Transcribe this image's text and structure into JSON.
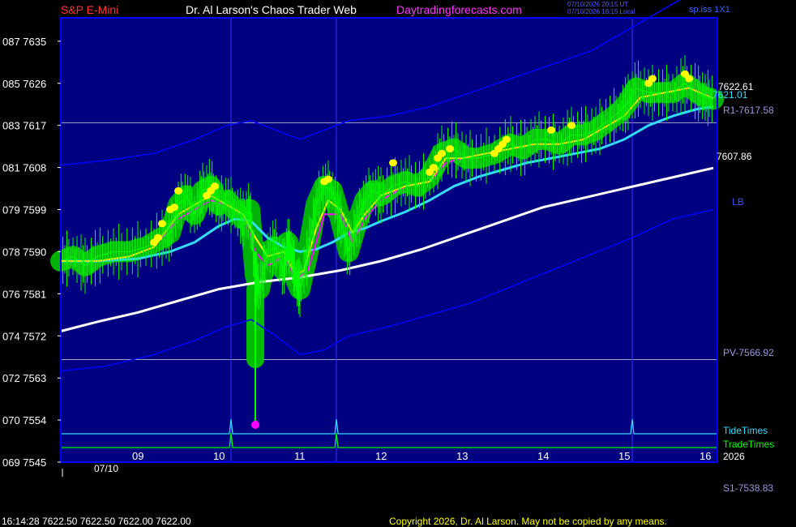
{
  "header": {
    "symbol": "S&P E-Mini",
    "author": "Dr. Al Larson's Chaos Trader Web",
    "site": "Daytradingforecasts.com",
    "stamp_utc": "07/10/2026 20:15 UT",
    "stamp_local": "07/10/2026 16:15 Local",
    "interval": "sp.iss 1X1"
  },
  "footer": {
    "quote": "16:14:28  7622.50 7622.50 7622.00 7622.00",
    "copyright": "Copyright 2026, Dr. Al Larson. May not be copied by any means."
  },
  "colors": {
    "background": "#000080",
    "frame": "#0000ff",
    "price": "#00ff00",
    "halo": "#00bb00",
    "fast_ma": "#ffff00",
    "mid_ma": "#ff00ff",
    "slow_ma": "#33ddff",
    "long_ma": "#ffffff",
    "band": "#0000ff",
    "tide": "#33ddff",
    "trade": "#00ff00",
    "marker": "#ff00ff",
    "dot": "#ffff00"
  },
  "chart_data": {
    "type": "line",
    "x_unit": "hour",
    "xlim": [
      8.05,
      16.15
    ],
    "ylim": [
      7545,
      7640
    ],
    "x_ticks": [
      9,
      10,
      11,
      12,
      13,
      14,
      15,
      16
    ],
    "x_tick_labels": [
      "09",
      "10",
      "11",
      "12",
      "13",
      "14",
      "15",
      "16"
    ],
    "date_label": "07/10",
    "year_label": "2026",
    "y_ticks": [
      {
        "price": 7635,
        "label": "087 7635"
      },
      {
        "price": 7626,
        "label": "085 7626"
      },
      {
        "price": 7617,
        "label": "083 7617"
      },
      {
        "price": 7608,
        "label": "081 7608"
      },
      {
        "price": 7599,
        "label": "079 7599"
      },
      {
        "price": 7590,
        "label": "078 7590"
      },
      {
        "price": 7581,
        "label": "076 7581"
      },
      {
        "price": 7572,
        "label": "074 7572"
      },
      {
        "price": 7563,
        "label": "072 7563"
      },
      {
        "price": 7554,
        "label": "070 7554"
      },
      {
        "price": 7545,
        "label": "069 7545"
      }
    ],
    "levels": [
      {
        "name": "R1",
        "value": 7617.58,
        "label": "R1-7617.58"
      },
      {
        "name": "PV",
        "value": 7566.92,
        "label": "PV-7566.92"
      },
      {
        "name": "S1",
        "value": 7538.83,
        "label": "S1-7538.83"
      }
    ],
    "right_labels": {
      "last_price": "7622.61",
      "slow_ma": "7621.01",
      "long_ma": "7607.86",
      "band": "LB",
      "tide": "TideTimes",
      "trade": "TradeTimes"
    },
    "vertical_lines": [
      10.15,
      11.45,
      15.1
    ],
    "tide_times": [
      10.15,
      11.45,
      15.1
    ],
    "trade_times": [
      10.15,
      11.45
    ],
    "low_marker": {
      "x": 10.45,
      "y": 7553
    },
    "series": [
      {
        "key": "price",
        "points": [
          [
            8.05,
            7588
          ],
          [
            8.2,
            7589
          ],
          [
            8.35,
            7587
          ],
          [
            8.5,
            7589
          ],
          [
            8.7,
            7590
          ],
          [
            8.9,
            7590
          ],
          [
            9.1,
            7591
          ],
          [
            9.3,
            7593
          ],
          [
            9.4,
            7594
          ],
          [
            9.5,
            7600
          ],
          [
            9.6,
            7602
          ],
          [
            9.7,
            7598
          ],
          [
            9.8,
            7603
          ],
          [
            9.9,
            7604
          ],
          [
            10.0,
            7600
          ],
          [
            10.1,
            7601
          ],
          [
            10.2,
            7599
          ],
          [
            10.3,
            7597
          ],
          [
            10.38,
            7599
          ],
          [
            10.45,
            7585
          ],
          [
            10.5,
            7582
          ],
          [
            10.6,
            7590
          ],
          [
            10.7,
            7591
          ],
          [
            10.8,
            7586
          ],
          [
            10.85,
            7592
          ],
          [
            10.9,
            7589
          ],
          [
            10.95,
            7584
          ],
          [
            11.0,
            7582
          ],
          [
            11.1,
            7590
          ],
          [
            11.2,
            7600
          ],
          [
            11.3,
            7604
          ],
          [
            11.4,
            7603
          ],
          [
            11.5,
            7597
          ],
          [
            11.6,
            7590
          ],
          [
            11.7,
            7596
          ],
          [
            11.8,
            7601
          ],
          [
            11.9,
            7603
          ],
          [
            12.0,
            7602
          ],
          [
            12.15,
            7604
          ],
          [
            12.3,
            7605
          ],
          [
            12.45,
            7604
          ],
          [
            12.6,
            7606
          ],
          [
            12.75,
            7611
          ],
          [
            12.9,
            7612
          ],
          [
            13.05,
            7610
          ],
          [
            13.2,
            7610
          ],
          [
            13.4,
            7611
          ],
          [
            13.6,
            7613
          ],
          [
            13.75,
            7612
          ],
          [
            13.9,
            7614
          ],
          [
            14.05,
            7614
          ],
          [
            14.2,
            7613
          ],
          [
            14.35,
            7615
          ],
          [
            14.5,
            7615
          ],
          [
            14.65,
            7616
          ],
          [
            14.8,
            7618
          ],
          [
            14.95,
            7620
          ],
          [
            15.05,
            7622
          ],
          [
            15.15,
            7625
          ],
          [
            15.3,
            7624
          ],
          [
            15.45,
            7624
          ],
          [
            15.6,
            7624
          ],
          [
            15.75,
            7626
          ],
          [
            15.9,
            7624
          ],
          [
            16.0,
            7623
          ],
          [
            16.1,
            7622.6
          ]
        ]
      },
      {
        "key": "fast_ma",
        "points": [
          [
            8.05,
            7588
          ],
          [
            8.5,
            7588
          ],
          [
            8.9,
            7589
          ],
          [
            9.2,
            7591
          ],
          [
            9.5,
            7598
          ],
          [
            9.7,
            7600
          ],
          [
            9.9,
            7602
          ],
          [
            10.1,
            7600
          ],
          [
            10.3,
            7598
          ],
          [
            10.45,
            7593
          ],
          [
            10.6,
            7589
          ],
          [
            10.8,
            7590
          ],
          [
            10.95,
            7585
          ],
          [
            11.05,
            7586
          ],
          [
            11.2,
            7595
          ],
          [
            11.35,
            7601
          ],
          [
            11.5,
            7599
          ],
          [
            11.65,
            7594
          ],
          [
            11.8,
            7598
          ],
          [
            12.0,
            7602
          ],
          [
            12.3,
            7604
          ],
          [
            12.6,
            7605
          ],
          [
            12.8,
            7610
          ],
          [
            13.0,
            7610
          ],
          [
            13.3,
            7611
          ],
          [
            13.6,
            7612
          ],
          [
            13.9,
            7613
          ],
          [
            14.2,
            7613
          ],
          [
            14.5,
            7614
          ],
          [
            14.8,
            7617
          ],
          [
            15.0,
            7619
          ],
          [
            15.2,
            7623
          ],
          [
            15.5,
            7624
          ],
          [
            15.8,
            7625
          ],
          [
            16.1,
            7622.8
          ]
        ]
      },
      {
        "key": "mid_ma",
        "points": [
          [
            8.05,
            7588
          ],
          [
            8.5,
            7588
          ],
          [
            8.9,
            7589
          ],
          [
            9.2,
            7591
          ],
          [
            9.5,
            7597
          ],
          [
            9.7,
            7599
          ],
          [
            9.9,
            7601
          ],
          [
            10.1,
            7600
          ],
          [
            10.3,
            7598
          ],
          [
            10.45,
            7590
          ],
          [
            10.6,
            7587
          ],
          [
            10.8,
            7589
          ],
          [
            10.95,
            7584
          ],
          [
            11.1,
            7586
          ],
          [
            11.3,
            7598
          ],
          [
            11.5,
            7598
          ],
          [
            11.65,
            7592
          ],
          [
            11.8,
            7597
          ],
          [
            12.0,
            7601
          ],
          [
            12.3,
            7604
          ],
          [
            12.6,
            7605
          ],
          [
            12.8,
            7609
          ],
          [
            13.0,
            7610
          ],
          [
            13.3,
            7611
          ],
          [
            13.6,
            7612
          ],
          [
            13.9,
            7613
          ],
          [
            14.2,
            7613
          ],
          [
            14.5,
            7614
          ],
          [
            14.8,
            7617
          ],
          [
            15.0,
            7619
          ],
          [
            15.2,
            7623
          ],
          [
            15.5,
            7624
          ],
          [
            15.8,
            7625
          ],
          [
            16.1,
            7623
          ]
        ]
      },
      {
        "key": "slow_ma",
        "points": [
          [
            8.05,
            7588
          ],
          [
            8.5,
            7588
          ],
          [
            9.0,
            7588.5
          ],
          [
            9.4,
            7590
          ],
          [
            9.7,
            7592
          ],
          [
            10.0,
            7595.5
          ],
          [
            10.2,
            7597
          ],
          [
            10.4,
            7596.5
          ],
          [
            10.6,
            7593
          ],
          [
            10.8,
            7591
          ],
          [
            11.0,
            7590
          ],
          [
            11.2,
            7590.5
          ],
          [
            11.4,
            7592
          ],
          [
            11.6,
            7594
          ],
          [
            11.8,
            7595
          ],
          [
            12.0,
            7596.5
          ],
          [
            12.3,
            7598.5
          ],
          [
            12.6,
            7601
          ],
          [
            12.9,
            7604
          ],
          [
            13.2,
            7606
          ],
          [
            13.5,
            7607.5
          ],
          [
            13.8,
            7609
          ],
          [
            14.1,
            7610
          ],
          [
            14.4,
            7611
          ],
          [
            14.7,
            7612
          ],
          [
            15.0,
            7614
          ],
          [
            15.3,
            7617
          ],
          [
            15.6,
            7619
          ],
          [
            15.9,
            7620.5
          ],
          [
            16.1,
            7621
          ]
        ]
      },
      {
        "key": "long_ma",
        "points": [
          [
            8.05,
            7573
          ],
          [
            8.5,
            7575
          ],
          [
            9.0,
            7577
          ],
          [
            9.5,
            7579.5
          ],
          [
            10.0,
            7582
          ],
          [
            10.5,
            7583.5
          ],
          [
            11.0,
            7584.5
          ],
          [
            11.5,
            7586
          ],
          [
            12.0,
            7588
          ],
          [
            12.5,
            7590.5
          ],
          [
            13.0,
            7593.5
          ],
          [
            13.5,
            7596.5
          ],
          [
            14.0,
            7599.5
          ],
          [
            14.5,
            7601.5
          ],
          [
            15.0,
            7603.5
          ],
          [
            15.5,
            7605.5
          ],
          [
            16.1,
            7607.9
          ]
        ]
      },
      {
        "key": "band",
        "points": [
          [
            8.05,
            7608.5
          ],
          [
            8.6,
            7609.5
          ],
          [
            9.2,
            7611
          ],
          [
            9.7,
            7614
          ],
          [
            10.1,
            7617
          ],
          [
            10.4,
            7618
          ],
          [
            10.7,
            7616
          ],
          [
            11.0,
            7614
          ],
          [
            11.3,
            7616
          ],
          [
            11.6,
            7618
          ],
          [
            12.1,
            7619
          ],
          [
            12.6,
            7621
          ],
          [
            13.1,
            7624
          ],
          [
            13.6,
            7627
          ],
          [
            14.1,
            7630
          ],
          [
            14.6,
            7633
          ],
          [
            15.0,
            7637
          ],
          [
            15.6,
            7643
          ],
          [
            16.1,
            7648
          ]
        ]
      },
      {
        "key": "band",
        "points": [
          [
            8.05,
            7564.5
          ],
          [
            8.6,
            7565.5
          ],
          [
            9.2,
            7568
          ],
          [
            9.7,
            7571
          ],
          [
            10.1,
            7574
          ],
          [
            10.4,
            7575.5
          ],
          [
            10.7,
            7572
          ],
          [
            11.0,
            7568
          ],
          [
            11.3,
            7569
          ],
          [
            11.6,
            7572
          ],
          [
            12.1,
            7574
          ],
          [
            12.6,
            7576.5
          ],
          [
            13.1,
            7579
          ],
          [
            13.6,
            7582.5
          ],
          [
            14.1,
            7586
          ],
          [
            14.6,
            7589.5
          ],
          [
            15.1,
            7593
          ],
          [
            15.6,
            7597
          ],
          [
            16.1,
            7599
          ]
        ]
      }
    ],
    "dots": [
      [
        9.2,
        7592
      ],
      [
        9.25,
        7593
      ],
      [
        9.3,
        7596
      ],
      [
        9.4,
        7599
      ],
      [
        9.45,
        7599.5
      ],
      [
        9.5,
        7603
      ],
      [
        9.85,
        7602
      ],
      [
        9.9,
        7603
      ],
      [
        9.95,
        7604
      ],
      [
        11.3,
        7605
      ],
      [
        11.35,
        7605.5
      ],
      [
        12.15,
        7609
      ],
      [
        12.6,
        7607
      ],
      [
        12.65,
        7608
      ],
      [
        12.7,
        7610
      ],
      [
        12.75,
        7611
      ],
      [
        12.85,
        7612
      ],
      [
        13.4,
        7611
      ],
      [
        13.45,
        7612
      ],
      [
        13.5,
        7613
      ],
      [
        13.55,
        7614
      ],
      [
        14.1,
        7616
      ],
      [
        14.35,
        7617
      ],
      [
        15.3,
        7626
      ],
      [
        15.35,
        7627
      ],
      [
        15.75,
        7628
      ],
      [
        15.8,
        7627
      ]
    ]
  }
}
